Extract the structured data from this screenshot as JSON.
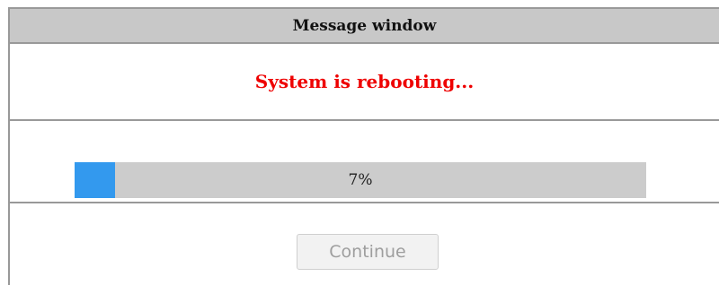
{
  "window": {
    "title": "Message window"
  },
  "message": {
    "text": "System is rebooting...",
    "color": "#ee0000"
  },
  "progress": {
    "percent": 7,
    "label": "7%",
    "fill_color": "#3399ee",
    "track_color": "#cccccc"
  },
  "actions": {
    "continue_label": "Continue",
    "continue_enabled": false
  }
}
